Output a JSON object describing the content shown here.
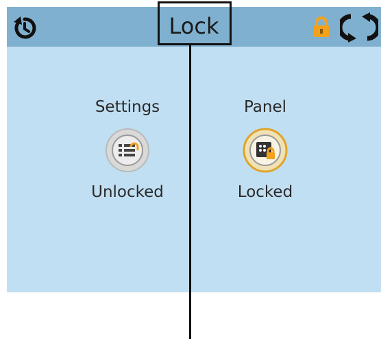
{
  "header": {
    "title": "Lock",
    "back_icon": "rotate-back-icon",
    "lock_icon": "padlock-icon",
    "refresh_icon": "refresh-icon"
  },
  "tiles": [
    {
      "label": "Settings",
      "state": "Unlocked",
      "icon": "settings-list-icon"
    },
    {
      "label": "Panel",
      "state": "Locked",
      "icon": "keypad-lock-icon"
    }
  ],
  "colors": {
    "screen_bg": "#c1dff2",
    "header_bg": "#7fb0cf",
    "lock_accent": "#f2a21c"
  }
}
